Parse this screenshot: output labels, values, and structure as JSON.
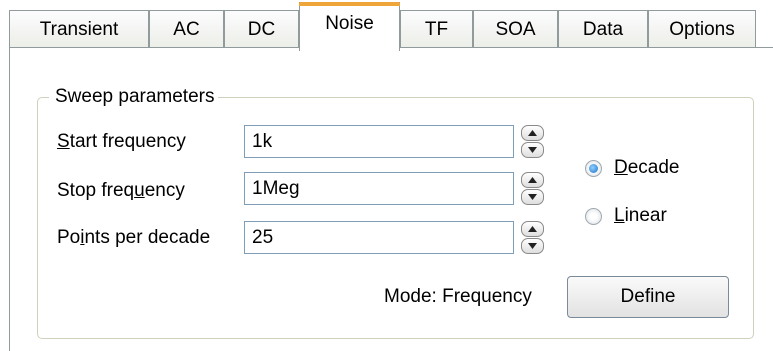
{
  "tabs": {
    "transient": "Transient",
    "ac": "AC",
    "dc": "DC",
    "noise": "Noise",
    "tf": "TF",
    "soa": "SOA",
    "data": "Data",
    "options": "Options",
    "active": "Noise"
  },
  "sweep": {
    "group_label": "Sweep parameters",
    "start": {
      "pre": "",
      "key": "S",
      "post": "tart frequency",
      "value": "1k"
    },
    "stop": {
      "pre": "Stop freq",
      "key": "u",
      "post": "ency",
      "value": "1Meg"
    },
    "points": {
      "pre": "Po",
      "key": "i",
      "post": "nts per decade",
      "value": "25"
    },
    "decade": {
      "pre": "",
      "key": "D",
      "post": "ecade",
      "selected": true
    },
    "linear": {
      "pre": "",
      "key": "L",
      "post": "inear",
      "selected": false
    },
    "mode_text": "Mode: Frequency",
    "define_label": "Define"
  },
  "icons": {
    "spin_up": "triangle-up",
    "spin_down": "triangle-down"
  },
  "colors": {
    "active_tab_accent": "#f0a53a",
    "field_border": "#7f9db9",
    "radio_selected": "#1e6fc8"
  }
}
